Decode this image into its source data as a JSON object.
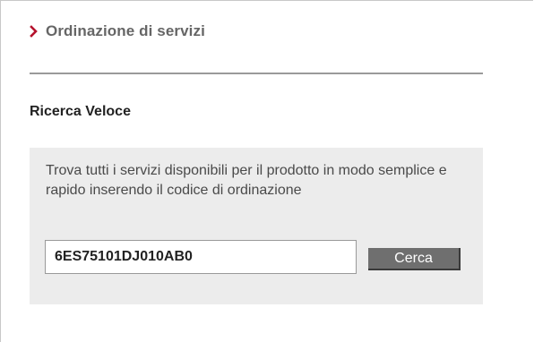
{
  "header": {
    "title": "Ordinazione di servizi",
    "icon": "chevron-right-icon",
    "accent_color": "#b5122d"
  },
  "quick_search": {
    "title": "Ricerca Veloce",
    "description": "Trova tutti i servizi disponibili per il prodotto in modo semplice e rapido inserendo il codice di ordinazione",
    "input_value": "6ES75101DJ010AB0",
    "button_label": "Cerca"
  }
}
